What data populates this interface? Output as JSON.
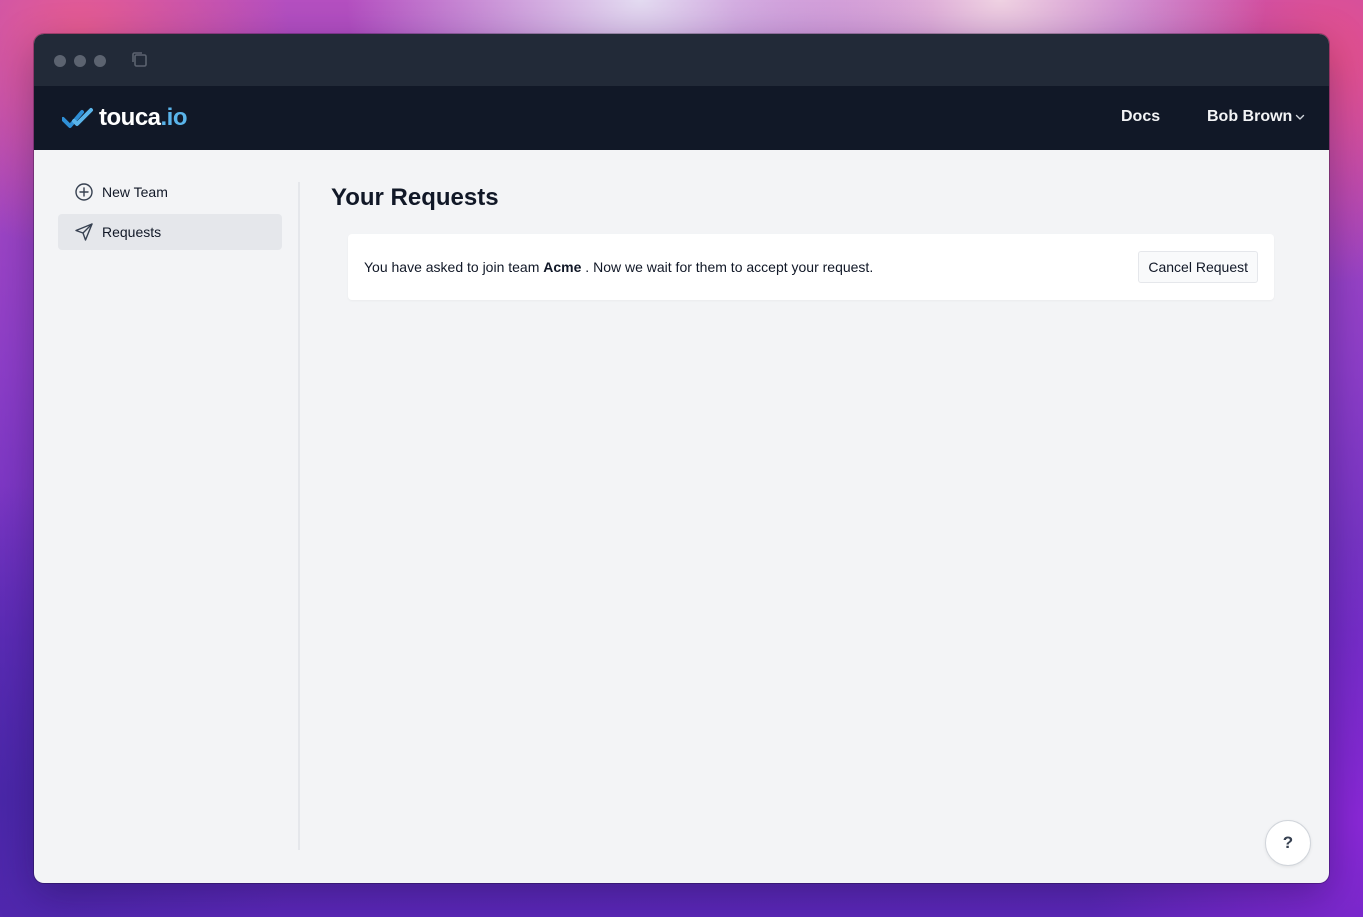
{
  "brand": {
    "name_main": "touca",
    "name_accent": ".io",
    "accent_color": "#5ab4ea"
  },
  "nav": {
    "docs_label": "Docs",
    "user_name": "Bob Brown"
  },
  "sidebar": {
    "items": [
      {
        "label": "New Team",
        "icon": "plus-circle-icon"
      },
      {
        "label": "Requests",
        "icon": "paper-plane-icon",
        "active": true
      }
    ]
  },
  "main": {
    "title": "Your Requests",
    "request": {
      "text_before": "You have asked to join team ",
      "team_name": "Acme",
      "text_after": " . Now we wait for them to accept your request.",
      "cancel_label": "Cancel Request"
    }
  },
  "help": {
    "label": "?"
  }
}
